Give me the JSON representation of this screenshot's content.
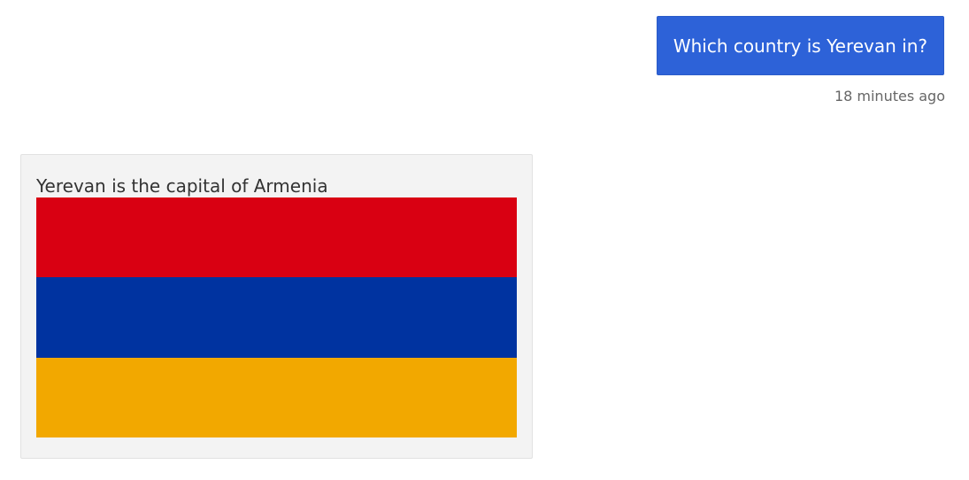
{
  "conversation": {
    "user_message": {
      "text": "Which country is Yerevan in?",
      "timestamp": "18 minutes ago",
      "bubble_color": "#2d62d8"
    },
    "bot_message": {
      "text": "Yerevan is the capital of Armenia",
      "image": {
        "subject": "flag-of-armenia",
        "stripes": [
          "#d90012",
          "#0033a0",
          "#f2a800"
        ]
      }
    }
  }
}
